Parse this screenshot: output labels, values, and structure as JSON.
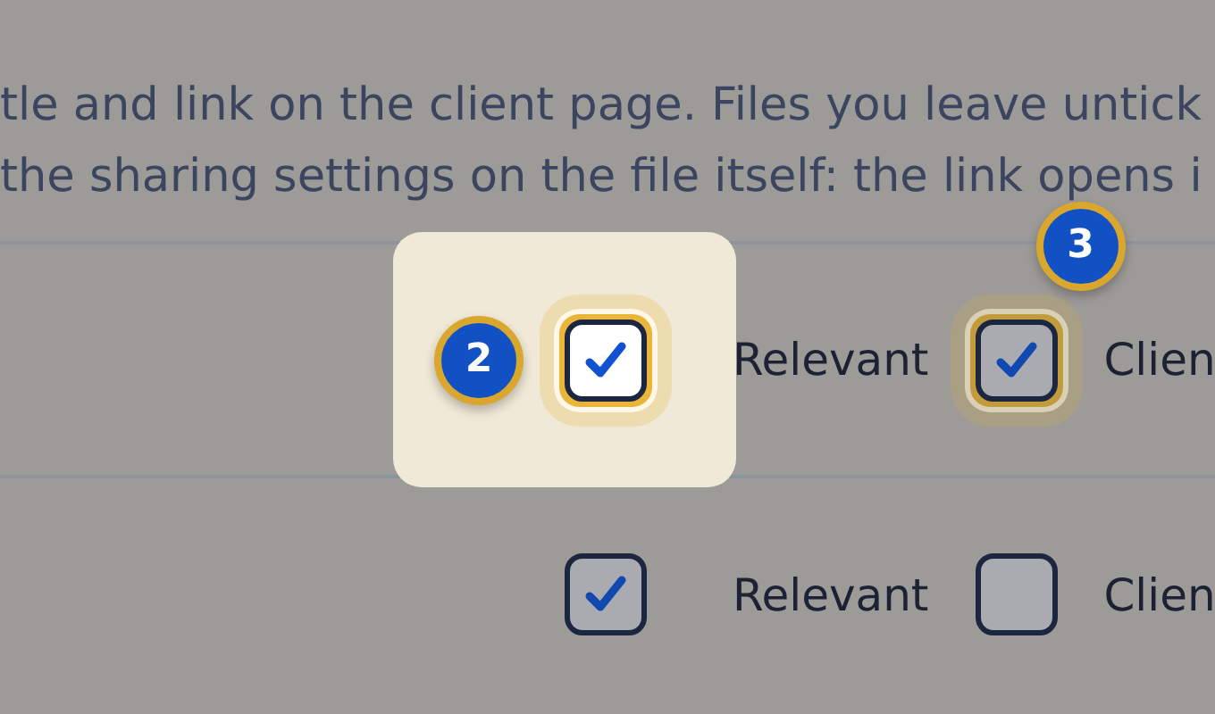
{
  "intro_lines": [
    "tle and link on the client page. Files you leave untick",
    "the sharing settings on the file itself: the link opens i"
  ],
  "rows": [
    {
      "options": [
        {
          "label": "Relevant",
          "checked": true,
          "kind": "spotlight",
          "badge": "2"
        },
        {
          "label": "Clien",
          "checked": true,
          "kind": "ring",
          "badge": "3"
        }
      ]
    },
    {
      "options": [
        {
          "label": "Relevant",
          "checked": true,
          "kind": "plain"
        },
        {
          "label": "Clien",
          "checked": false,
          "kind": "plain"
        }
      ]
    }
  ]
}
